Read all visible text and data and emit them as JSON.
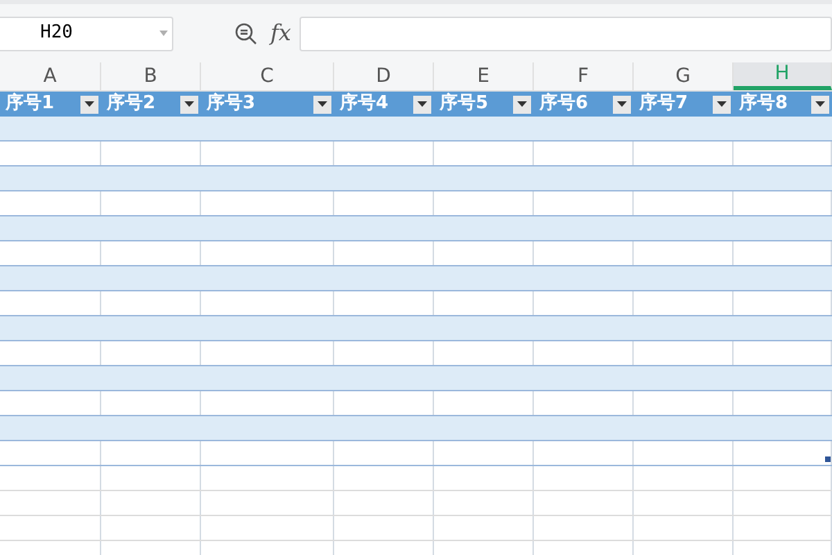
{
  "name_box": {
    "value": "H20"
  },
  "formula_bar": {
    "fx": "fx"
  },
  "column_headers": [
    {
      "label": "A",
      "selected": false
    },
    {
      "label": "B",
      "selected": false
    },
    {
      "label": "C",
      "selected": false
    },
    {
      "label": "D",
      "selected": false
    },
    {
      "label": "E",
      "selected": false
    },
    {
      "label": "F",
      "selected": false
    },
    {
      "label": "G",
      "selected": false
    },
    {
      "label": "H",
      "selected": true
    }
  ],
  "table": {
    "columns": [
      "序号1",
      "序号2",
      "序号3",
      "序号4",
      "序号5",
      "序号6",
      "序号7",
      "序号8"
    ]
  }
}
